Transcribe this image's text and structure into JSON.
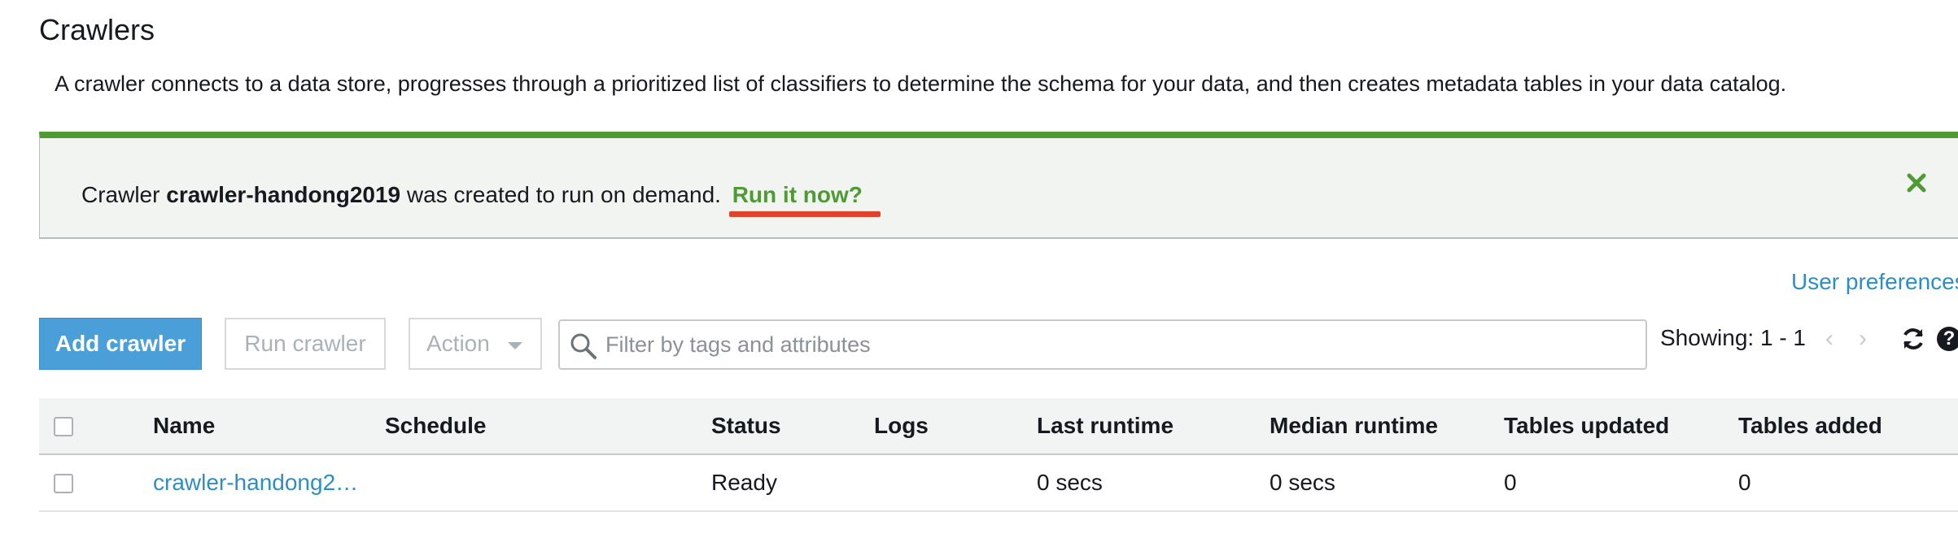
{
  "page": {
    "title": "Crawlers",
    "description": "A crawler connects to a data store, progresses through a prioritized list of classifiers to determine the schema for your data, and then creates metadata tables in your data catalog."
  },
  "flash": {
    "prefix": "Crawler",
    "crawler_name": "crawler-handong2019",
    "message": "was created to run on demand.",
    "run_link": "Run it now?",
    "close_icon": "close-icon",
    "accent_color": "#4f9a33"
  },
  "toolbar": {
    "user_preferences": "User preferences",
    "add_label": "Add crawler",
    "run_label": "Run crawler",
    "action_label": "Action",
    "search_placeholder": "Filter by tags and attributes",
    "search_value": "",
    "showing": "Showing: 1 - 1",
    "prev_icon": "chevron-left-icon",
    "next_icon": "chevron-right-icon",
    "refresh_icon": "refresh-icon",
    "help_icon": "help-icon",
    "primary_color": "#4a9fd8"
  },
  "table": {
    "columns": [
      "Name",
      "Schedule",
      "Status",
      "Logs",
      "Last runtime",
      "Median runtime",
      "Tables updated",
      "Tables added"
    ],
    "rows": [
      {
        "name": "crawler-handong2…",
        "schedule": "",
        "status": "Ready",
        "logs": "",
        "last_runtime": "0 secs",
        "median_runtime": "0 secs",
        "tables_updated": "0",
        "tables_added": "0",
        "checked": false
      }
    ]
  },
  "colors": {
    "link": "#2e8ec4",
    "annotation_underline": "#e0432a"
  }
}
